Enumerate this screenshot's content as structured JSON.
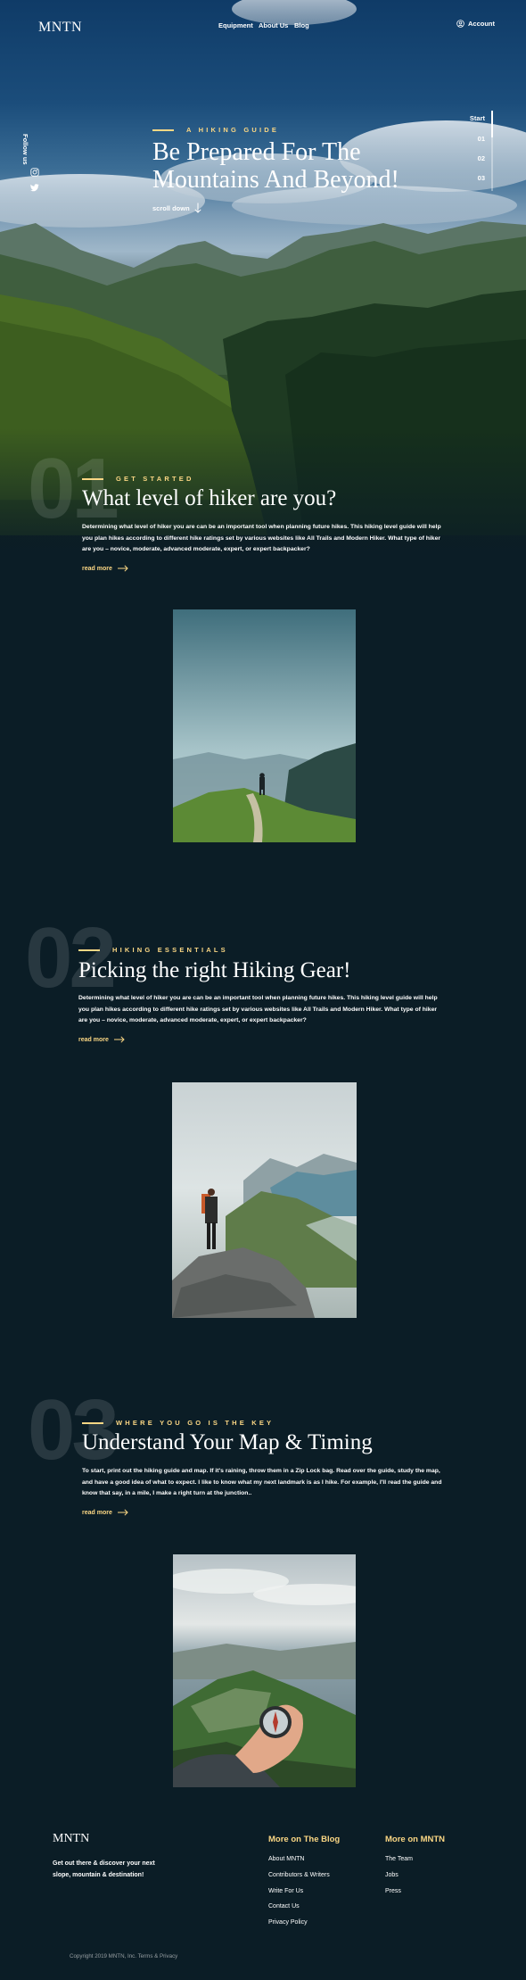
{
  "header": {
    "logo": "MNTN",
    "nav": [
      "Equipment",
      "About Us",
      "Blog"
    ],
    "account": "Account"
  },
  "hero": {
    "follow": "Follow us",
    "eyebrow": "A HIKING GUIDE",
    "title": "Be Prepared For The Mountains And Beyond!",
    "scroll": "scroll down",
    "pager": [
      "Start",
      "01",
      "02",
      "03"
    ],
    "pager_active_fraction": 0.33
  },
  "sections": [
    {
      "number": "01",
      "eyebrow": "GET STARTED",
      "title": "What level of hiker are you?",
      "body": "Determining what level of hiker you are can be an important tool when planning future hikes. This hiking level guide will help you plan hikes according to different hike ratings set by various websites like All Trails and Modern Hiker. What type of hiker are you – novice, moderate, advanced moderate, expert, or expert backpacker?",
      "cta": "read more"
    },
    {
      "number": "02",
      "eyebrow": "HIKING ESSENTIALS",
      "title": "Picking the right Hiking Gear!",
      "body": "Determining what level of hiker you are can be an important tool when planning future hikes. This hiking level guide will help you plan hikes according to different hike ratings set by various websites like All Trails and Modern Hiker. What type of hiker are you – novice, moderate, advanced moderate, expert, or expert backpacker?",
      "cta": "read more"
    },
    {
      "number": "03",
      "eyebrow": "WHERE YOU GO IS THE KEY",
      "title": "Understand Your Map & Timing",
      "body": "To start, print out the hiking guide and map. If it's raining, throw them in a Zip Lock bag. Read over the guide, study the map, and have a good idea of what to expect. I like to know what my next landmark is as I hike. For example, I'll read the guide and know that say, in a mile, I make a right turn at the junction..",
      "cta": "read more"
    }
  ],
  "footer": {
    "logo": "MNTN",
    "tagline": "Get out there & discover your next slope, mountain & destination!",
    "blog_heading": "More on The Blog",
    "blog_links": [
      "About MNTN",
      "Contributors & Writers",
      "Write For Us",
      "Contact Us",
      "Privacy Policy"
    ],
    "mntn_heading": "More on MNTN",
    "mntn_links": [
      "The Team",
      "Jobs",
      "Press"
    ],
    "copyright": "Copyright 2019 MNTN, Inc. Terms & Privacy"
  },
  "colors": {
    "accent": "#fbd784",
    "background": "#0b1d26"
  }
}
